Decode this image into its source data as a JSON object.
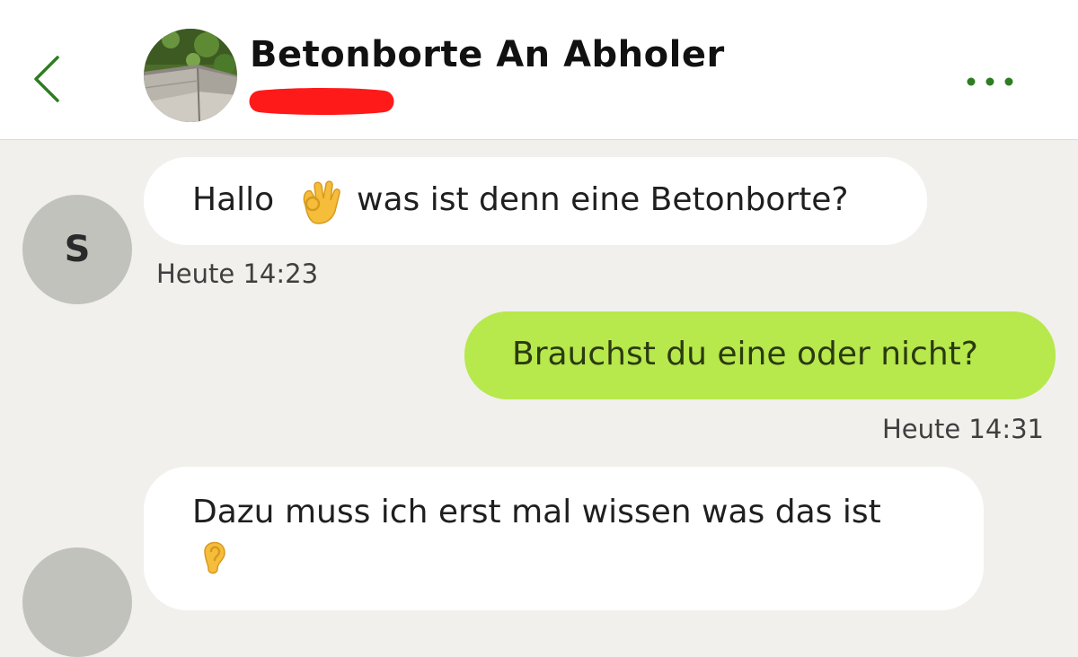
{
  "header": {
    "title": "Betonborte An Abholer",
    "back_icon": "chevron-left-icon",
    "more_icon": "more-horizontal-icon",
    "accent_color": "#2e7d22"
  },
  "messages": [
    {
      "direction": "incoming",
      "avatar_initial": "S",
      "text_before_emoji": "Hallo",
      "emoji": "ok-hand-emoji",
      "text_after_emoji": "was ist denn eine Betonborte?",
      "time": "Heute 14:23"
    },
    {
      "direction": "outgoing",
      "text": "Brauchst du eine oder nicht?",
      "time": "Heute 14:31"
    },
    {
      "direction": "incoming",
      "text": "Dazu muss ich erst mal wissen was das ist",
      "emoji": "ear-emoji"
    }
  ],
  "colors": {
    "chat_background": "#f1f0ec",
    "incoming_bubble": "#ffffff",
    "outgoing_bubble": "#b7e84c",
    "avatar_placeholder": "#c2c2bd",
    "redaction": "#ff1a1a"
  }
}
